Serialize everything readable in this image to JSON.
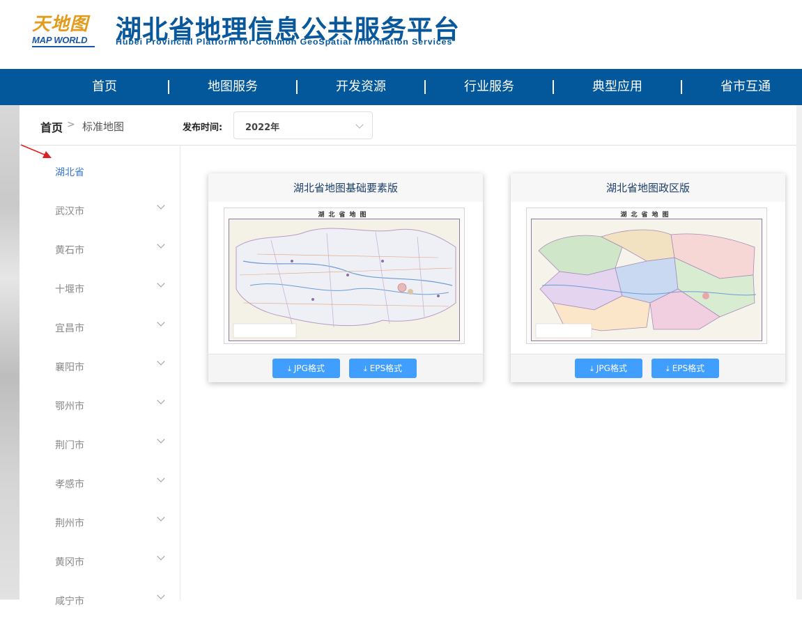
{
  "header": {
    "logo_cn": "天地图",
    "logo_en": "MAP WORLD",
    "title": "湖北省地理信息公共服务平台",
    "subtitle": "Hubei Provincial Platform for Common GeoSpatial Information Services"
  },
  "nav": {
    "items": [
      "首页",
      "地图服务",
      "开发资源",
      "行业服务",
      "典型应用",
      "省市互通"
    ]
  },
  "breadcrumb": {
    "home": "首页",
    "separator": ">",
    "current": "标准地图"
  },
  "filter": {
    "label": "发布时间:",
    "selected": "2022年"
  },
  "sidebar": {
    "items": [
      {
        "label": "湖北省",
        "active": true
      },
      {
        "label": "武汉市"
      },
      {
        "label": "黄石市"
      },
      {
        "label": "十堰市"
      },
      {
        "label": "宜昌市"
      },
      {
        "label": "襄阳市"
      },
      {
        "label": "鄂州市"
      },
      {
        "label": "荆门市"
      },
      {
        "label": "孝感市"
      },
      {
        "label": "荆州市"
      },
      {
        "label": "黄冈市"
      },
      {
        "label": "咸宁市"
      }
    ]
  },
  "cards": [
    {
      "title": "湖北省地图基础要素版",
      "map_title": "湖北省地图",
      "buttons": [
        "JPG格式",
        "EPS格式"
      ]
    },
    {
      "title": "湖北省地图政区版",
      "map_title": "湖北省地图",
      "buttons": [
        "JPG格式",
        "EPS格式"
      ]
    }
  ],
  "icons": {
    "download": "download-icon"
  },
  "colors": {
    "brand_blue": "#03579b",
    "title_blue": "#08589b",
    "button_blue": "#409eff",
    "active_link": "#3a78d6",
    "annotation_red": "#e02020"
  }
}
